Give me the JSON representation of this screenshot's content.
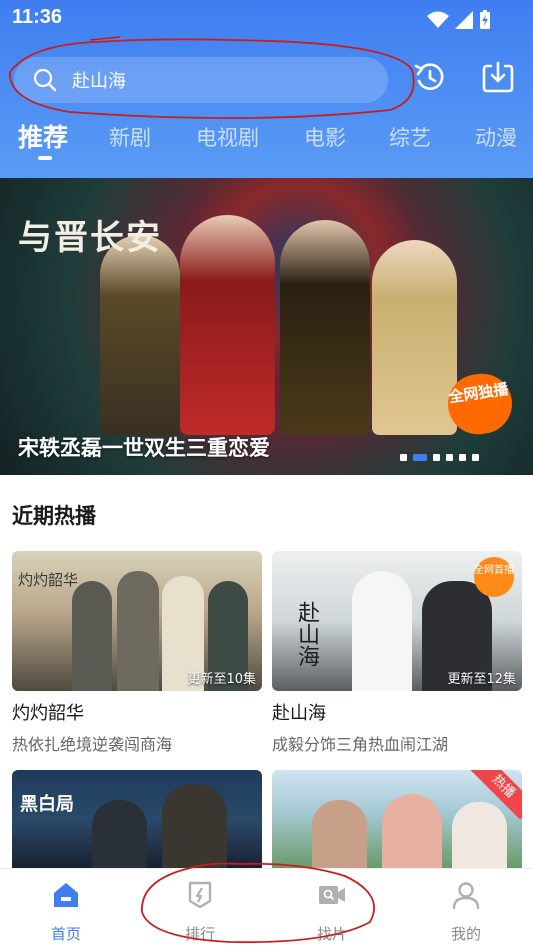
{
  "status_bar": {
    "time": "11:36"
  },
  "search": {
    "query": "赴山海"
  },
  "header_icons": [
    "history-icon",
    "download-icon"
  ],
  "tabs": [
    {
      "label": "推荐",
      "active": true
    },
    {
      "label": "新剧"
    },
    {
      "label": "电视剧"
    },
    {
      "label": "电影"
    },
    {
      "label": "综艺"
    },
    {
      "label": "动漫"
    }
  ],
  "banner": {
    "title_art": "与晋长安",
    "caption": "宋轶丞磊一世双生三重恋爱",
    "badge": "全网独播",
    "slide_count": 6,
    "active_slide": 2
  },
  "section": {
    "title": "近期热播"
  },
  "cards": [
    {
      "thumb_text": "灼灼韶华",
      "update": "更新至10集",
      "title": "灼灼韶华",
      "subtitle": "热依扎绝境逆袭闯商海"
    },
    {
      "thumb_text": "赴山海",
      "update": "更新至12集",
      "title": "赴山海",
      "subtitle": "成毅分饰三角热血闹江湖",
      "corner_badge": "全网首播"
    }
  ],
  "row2": [
    {
      "thumb_text": "黑白局"
    },
    {
      "thumb_text": "",
      "hot_badge": "热播"
    }
  ],
  "nav": [
    {
      "label": "首页",
      "icon": "home-icon",
      "active": true
    },
    {
      "label": "排行",
      "icon": "ranking-icon"
    },
    {
      "label": "找片",
      "icon": "video-search-icon"
    },
    {
      "label": "我的",
      "icon": "profile-icon"
    }
  ],
  "colors": {
    "brand": "#3f7ef0",
    "annotation": "#c81e1e"
  }
}
